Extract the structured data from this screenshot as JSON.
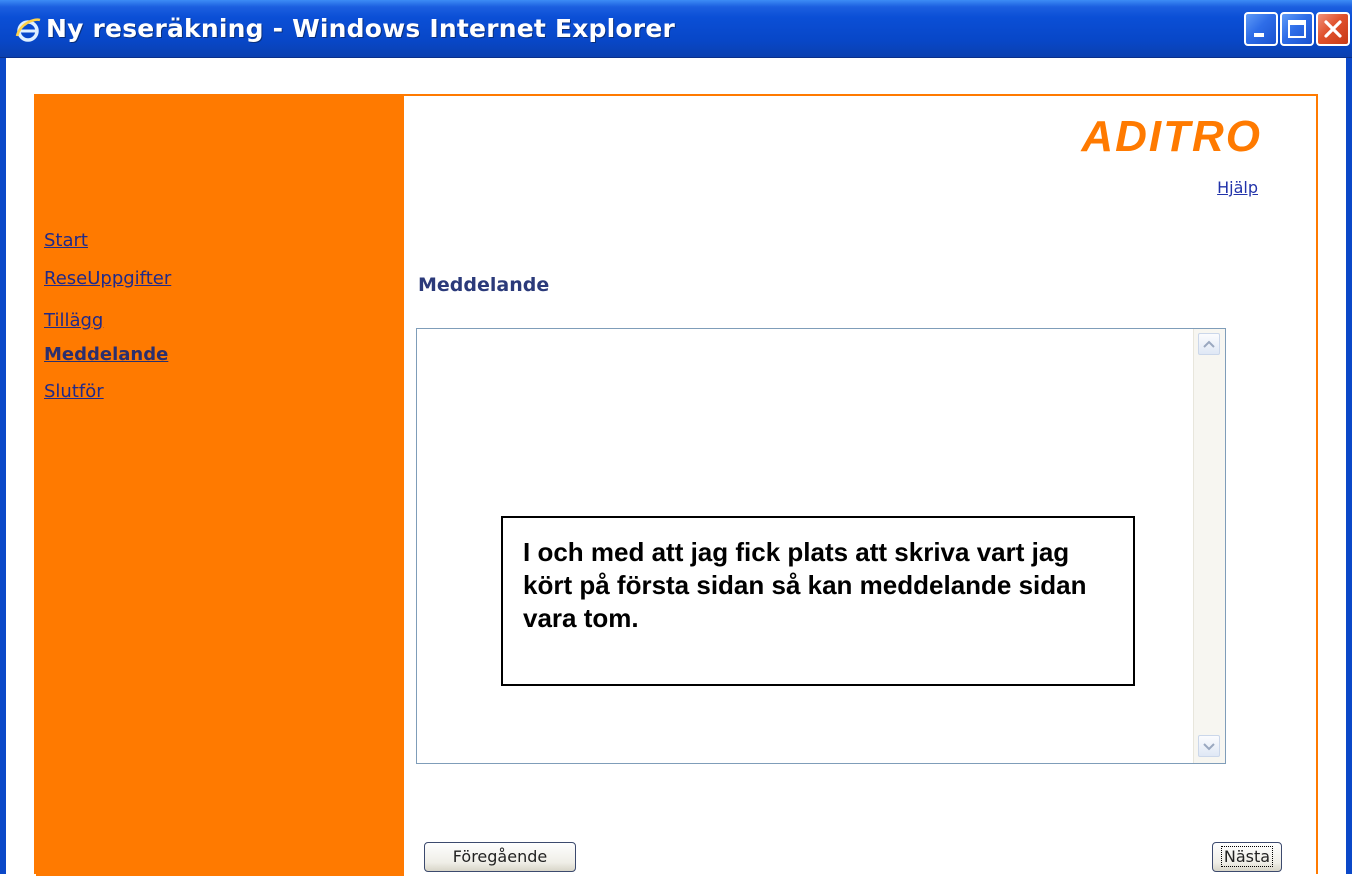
{
  "window": {
    "title": "Ny reseräkning - Windows Internet Explorer"
  },
  "sidebar": {
    "items": [
      {
        "label": "Start"
      },
      {
        "label": "ReseUppgifter"
      },
      {
        "label": "Tillägg"
      },
      {
        "label": "Meddelande",
        "current": true
      },
      {
        "label": "Slutför"
      }
    ]
  },
  "header": {
    "logo": "ADITRO",
    "help": "Hjälp"
  },
  "main": {
    "section_title": "Meddelande",
    "message_value": ""
  },
  "callout": {
    "text": "I och med att jag fick plats att skriva vart jag kört på första sidan så kan meddelande sidan vara tom."
  },
  "buttons": {
    "previous": "Föregående",
    "next": "Nästa"
  },
  "colors": {
    "accent": "#ff7a00",
    "titlebar": "#0b48c8"
  }
}
